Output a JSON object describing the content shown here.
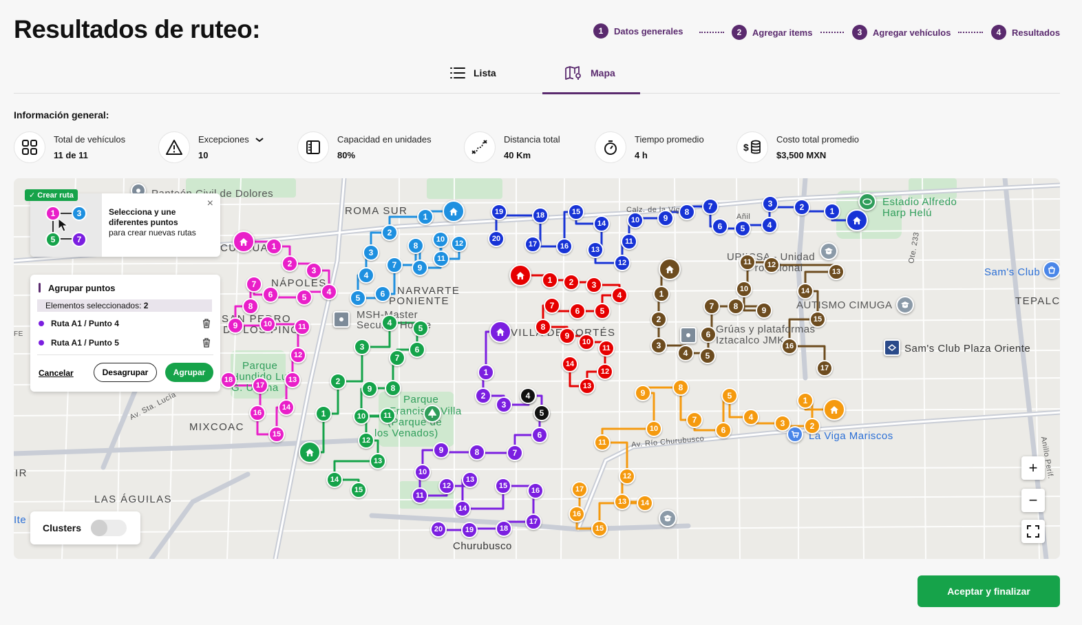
{
  "page": {
    "title": "Resultados de ruteo:"
  },
  "stepper": [
    {
      "num": "1",
      "label": "Datos generales"
    },
    {
      "num": "2",
      "label": "Agregar items"
    },
    {
      "num": "3",
      "label": "Agregar vehículos"
    },
    {
      "num": "4",
      "label": "Resultados"
    }
  ],
  "tabs": {
    "list_label": "Lista",
    "map_label": "Mapa",
    "active": "Mapa"
  },
  "info": {
    "title": "Información general:",
    "stats": [
      {
        "label": "Total de vehículos",
        "value": "11 de 11",
        "icon": "grid-icon"
      },
      {
        "label": "Excepciones",
        "value": "10",
        "icon": "warning-icon"
      },
      {
        "label": "Capacidad en unidades",
        "value": "80%",
        "icon": "capacity-icon"
      },
      {
        "label": "Distancia total",
        "value": "40 Km",
        "icon": "route-distance-icon"
      },
      {
        "label": "Tiempo promedio",
        "value": "4 h",
        "icon": "stopwatch-icon"
      },
      {
        "label": "Costo total promedio",
        "value": "$3,500 MXN",
        "icon": "money-icon"
      }
    ]
  },
  "create_route": {
    "badge": "✓ Crear ruta",
    "text_bold": "Selecciona y une diferentes puntos",
    "text_rest": "para crear nuevas rutas",
    "close": "×",
    "mini": [
      {
        "n": "1",
        "color": "#e91fc9"
      },
      {
        "n": "3",
        "color": "#1e90e0"
      },
      {
        "n": "5",
        "color": "#15a34a"
      },
      {
        "n": "7",
        "color": "#7b1fe0"
      }
    ]
  },
  "group_panel": {
    "title": "Agrupar puntos",
    "selected_label": "Elementos seleccionados:",
    "selected_count": "2",
    "items": [
      "Ruta A1 / Punto 4",
      "Ruta A1 / Punto 5"
    ],
    "cancel": "Cancelar",
    "ungroup": "Desagrupar",
    "group": "Agrupar"
  },
  "clusters": {
    "label": "Clusters",
    "enabled": false
  },
  "map_labels": [
    "Panteón Civil de Dolores",
    "ROMA SUR",
    "NÁPOLES",
    "NARVARTE",
    "PONIENTE",
    "SAN PEDRO",
    "DE LOS PINOS",
    "MSH-Master",
    "Security House",
    "VILLA DE CORTÉS",
    "Parque",
    "Hundido Luis",
    "G. Urbina",
    "Parque",
    "Francisco Villa",
    "(Parque de",
    "los Venados)",
    "MIXCOAC",
    "LAS ÁGUILAS",
    "Churubusco",
    "Av. Río Churubusco",
    "Av. Sta. Lucía",
    "Estadio Alfredo",
    "Harp Helú",
    "Sam's Club",
    "TEPALC",
    "UPIICSA - Unidad",
    "Profesional",
    "AUTISMO CIMUGA",
    "Sam's Club Plaza Oriente",
    "Grúas y plataformas",
    "Iztacalco JMK",
    "La Viga Mariscos",
    "Añil",
    "Calz. de la Viga",
    "Ote. 233",
    "Anillo Perif.",
    "CULHUA",
    "IR",
    "Ite",
    "FE"
  ],
  "map_controls": {
    "zoom_in": "+",
    "zoom_out": "−"
  },
  "actions": {
    "accept": "Aceptar y finalizar"
  },
  "routes": [
    {
      "color": "#e91fc9",
      "depot": [
        334,
        92
      ],
      "points": [
        [
          378,
          99,
          "1"
        ],
        [
          401,
          124,
          "2"
        ],
        [
          436,
          134,
          "3"
        ],
        [
          458,
          165,
          "4"
        ],
        [
          422,
          173,
          "5"
        ],
        [
          373,
          169,
          "6"
        ],
        [
          349,
          154,
          "7"
        ],
        [
          344,
          186,
          "8"
        ],
        [
          322,
          214,
          "9"
        ],
        [
          369,
          212,
          "10"
        ],
        [
          419,
          216,
          "11"
        ],
        [
          413,
          257,
          "12"
        ],
        [
          405,
          293,
          "13"
        ],
        [
          396,
          333,
          "14"
        ],
        [
          382,
          372,
          "15"
        ],
        [
          354,
          341,
          "16"
        ],
        [
          358,
          301,
          "17"
        ],
        [
          312,
          293,
          "18"
        ]
      ]
    },
    {
      "color": "#1e90e0",
      "depot": [
        639,
        48
      ],
      "points": [
        [
          598,
          56,
          "1"
        ],
        [
          546,
          79,
          "2"
        ],
        [
          519,
          108,
          "3"
        ],
        [
          512,
          141,
          "4"
        ],
        [
          500,
          174,
          "5"
        ],
        [
          536,
          168,
          "6"
        ],
        [
          553,
          126,
          "7"
        ],
        [
          584,
          98,
          "8"
        ],
        [
          590,
          130,
          "9"
        ],
        [
          620,
          89,
          "10"
        ],
        [
          621,
          117,
          "11"
        ],
        [
          647,
          95,
          "12"
        ]
      ]
    },
    {
      "color": "#15a34a",
      "depot": [
        430,
        398
      ],
      "points": [
        [
          450,
          342,
          "1"
        ],
        [
          471,
          295,
          "2"
        ],
        [
          506,
          245,
          "3"
        ],
        [
          546,
          210,
          "4"
        ],
        [
          591,
          218,
          "5"
        ],
        [
          586,
          249,
          "6"
        ],
        [
          557,
          261,
          "7"
        ],
        [
          551,
          305,
          "8"
        ],
        [
          517,
          306,
          "9"
        ],
        [
          505,
          346,
          "10"
        ],
        [
          543,
          345,
          "11"
        ],
        [
          512,
          381,
          "12"
        ],
        [
          529,
          411,
          "13"
        ],
        [
          466,
          438,
          "14"
        ],
        [
          501,
          453,
          "15"
        ]
      ]
    },
    {
      "color": "#1733d6",
      "depot": [
        1225,
        61
      ],
      "points": [
        [
          1189,
          48,
          "1"
        ],
        [
          1145,
          42,
          "2"
        ],
        [
          1099,
          37,
          "3"
        ],
        [
          1098,
          68,
          "4"
        ],
        [
          1059,
          73,
          "5"
        ],
        [
          1026,
          70,
          "6"
        ],
        [
          1012,
          41,
          "7"
        ],
        [
          978,
          49,
          "8"
        ],
        [
          947,
          58,
          "9"
        ],
        [
          903,
          61,
          "10"
        ],
        [
          894,
          92,
          "11"
        ],
        [
          884,
          123,
          "12"
        ],
        [
          845,
          104,
          "13"
        ],
        [
          854,
          66,
          "14"
        ],
        [
          817,
          49,
          "15"
        ],
        [
          800,
          99,
          "16"
        ],
        [
          754,
          96,
          "17"
        ],
        [
          765,
          54,
          "18"
        ],
        [
          705,
          49,
          "19"
        ],
        [
          701,
          88,
          "20"
        ]
      ]
    },
    {
      "color": "#e60000",
      "depot": [
        736,
        141
      ],
      "points": [
        [
          779,
          148,
          "1"
        ],
        [
          810,
          151,
          "2"
        ],
        [
          843,
          155,
          "3"
        ],
        [
          880,
          170,
          "4"
        ],
        [
          855,
          193,
          "5"
        ],
        [
          819,
          193,
          "6"
        ],
        [
          782,
          185,
          "7"
        ],
        [
          769,
          216,
          "8"
        ],
        [
          804,
          229,
          "9"
        ],
        [
          832,
          238,
          "10"
        ],
        [
          861,
          247,
          "11"
        ],
        [
          859,
          281,
          "12"
        ],
        [
          833,
          302,
          "13"
        ],
        [
          808,
          270,
          "14"
        ]
      ]
    },
    {
      "color": "#7b1fe0",
      "depot": [
        707,
        223
      ],
      "points": [
        [
          686,
          282,
          "1"
        ],
        [
          682,
          316,
          "2"
        ],
        [
          712,
          329,
          "3"
        ],
        [
          748,
          316,
          "4"
        ],
        [
          767,
          341,
          "5"
        ],
        [
          764,
          373,
          "6"
        ],
        [
          728,
          399,
          "7"
        ],
        [
          673,
          398,
          "8"
        ],
        [
          621,
          395,
          "9"
        ],
        [
          594,
          427,
          "10"
        ],
        [
          590,
          461,
          "11"
        ],
        [
          629,
          447,
          "12"
        ],
        [
          663,
          438,
          "13"
        ],
        [
          652,
          480,
          "14"
        ],
        [
          711,
          447,
          "15"
        ],
        [
          758,
          454,
          "16"
        ],
        [
          755,
          499,
          "17"
        ],
        [
          712,
          509,
          "18"
        ],
        [
          662,
          511,
          "19"
        ],
        [
          617,
          510,
          "20"
        ]
      ]
    },
    {
      "color": "#6d4c1f",
      "depot": [
        953,
        132
      ],
      "points": [
        [
          941,
          168,
          "1"
        ],
        [
          937,
          205,
          "2"
        ],
        [
          937,
          243,
          "3"
        ],
        [
          976,
          254,
          "4"
        ],
        [
          1008,
          258,
          "5"
        ],
        [
          1009,
          227,
          "6"
        ],
        [
          1014,
          186,
          "7"
        ],
        [
          1049,
          186,
          "8"
        ],
        [
          1090,
          192,
          "9"
        ],
        [
          1061,
          161,
          "10"
        ],
        [
          1066,
          122,
          "11"
        ],
        [
          1101,
          126,
          "12"
        ],
        [
          1195,
          136,
          "13"
        ],
        [
          1150,
          164,
          "14"
        ],
        [
          1168,
          205,
          "15"
        ],
        [
          1127,
          244,
          "16"
        ],
        [
          1178,
          276,
          "17"
        ]
      ]
    },
    {
      "color": "#f59a0f",
      "depot": [
        1192,
        336
      ],
      "points": [
        [
          1150,
          323,
          "1"
        ],
        [
          1160,
          360,
          "2"
        ],
        [
          1117,
          356,
          "3"
        ],
        [
          1071,
          347,
          "4"
        ],
        [
          1040,
          316,
          "5"
        ],
        [
          1031,
          366,
          "6"
        ],
        [
          989,
          351,
          "7"
        ],
        [
          969,
          304,
          "8"
        ],
        [
          914,
          312,
          "9"
        ],
        [
          930,
          364,
          "10"
        ],
        [
          855,
          384,
          "11"
        ],
        [
          891,
          433,
          "12"
        ],
        [
          884,
          470,
          "13"
        ],
        [
          917,
          472,
          "14"
        ],
        [
          851,
          509,
          "15"
        ],
        [
          818,
          488,
          "16"
        ],
        [
          822,
          452,
          "17"
        ]
      ]
    },
    {
      "color": "#111111",
      "depot": null,
      "points": [
        [
          747,
          316,
          "4"
        ],
        [
          767,
          341,
          "5"
        ]
      ]
    }
  ]
}
